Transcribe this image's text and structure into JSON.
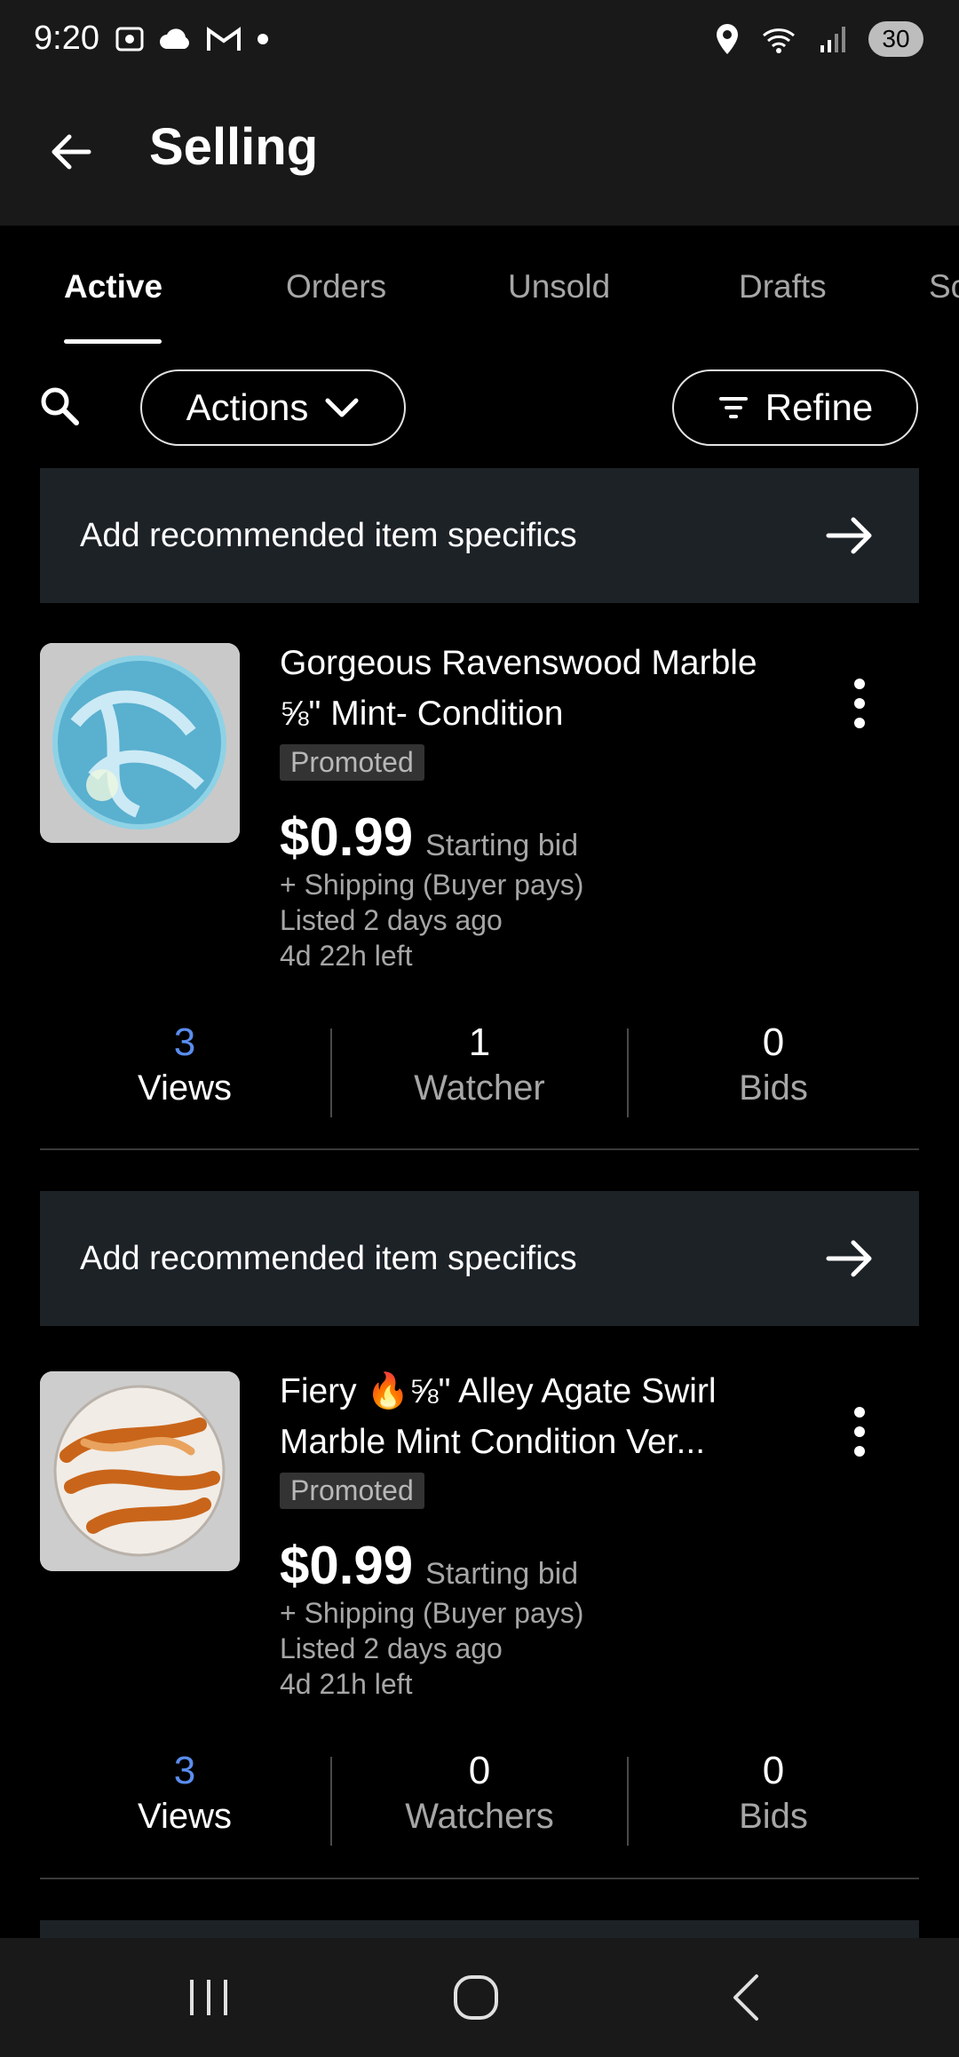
{
  "status_bar": {
    "time": "9:20",
    "battery": "30",
    "left_icons": [
      "screenshot-icon",
      "cloud-icon",
      "gmail-icon",
      "dot-icon"
    ],
    "right_icons": [
      "location-icon",
      "wifi-icon",
      "signal-icon",
      "battery-icon"
    ]
  },
  "app_bar": {
    "title": "Selling"
  },
  "tabs": [
    {
      "label": "Active",
      "active": true
    },
    {
      "label": "Orders",
      "active": false
    },
    {
      "label": "Unsold",
      "active": false
    },
    {
      "label": "Drafts",
      "active": false
    },
    {
      "label": "Sc",
      "active": false
    }
  ],
  "toolbar": {
    "actions_label": "Actions",
    "refine_label": "Refine"
  },
  "banner_text": "Add recommended item specifics",
  "listings": [
    {
      "title": "Gorgeous Ravenswood Marble ⅝\" Mint- Condition",
      "badge": "Promoted",
      "price": "$0.99",
      "price_type": "Starting bid",
      "shipping": "+ Shipping (Buyer pays)",
      "listed": "Listed 2 days ago",
      "time_left": "4d 22h left",
      "stats": [
        {
          "value": "3",
          "label": "Views"
        },
        {
          "value": "1",
          "label": "Watcher"
        },
        {
          "value": "0",
          "label": "Bids"
        }
      ]
    },
    {
      "title": "Fiery 🔥⅝\" Alley Agate Swirl Marble Mint Condition Ver...",
      "badge": "Promoted",
      "price": "$0.99",
      "price_type": "Starting bid",
      "shipping": "+ Shipping (Buyer pays)",
      "listed": "Listed 2 days ago",
      "time_left": "4d 21h left",
      "stats": [
        {
          "value": "3",
          "label": "Views"
        },
        {
          "value": "0",
          "label": "Watchers"
        },
        {
          "value": "0",
          "label": "Bids"
        }
      ]
    }
  ],
  "colors": {
    "accent_link": "#5a8dee",
    "banner_bg": "#1d2227",
    "app_bar_bg": "#191919"
  }
}
